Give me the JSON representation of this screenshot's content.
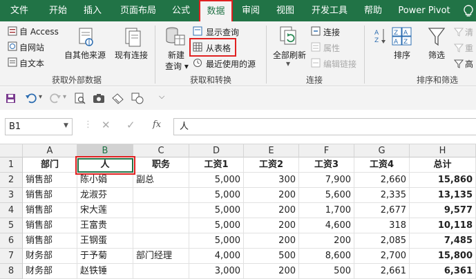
{
  "tabs": [
    {
      "label": "文件",
      "active": false
    },
    {
      "label": "开始",
      "active": false
    },
    {
      "label": "插入",
      "active": false
    },
    {
      "label": "页面布局",
      "active": false
    },
    {
      "label": "公式",
      "active": false
    },
    {
      "label": "数据",
      "active": true
    },
    {
      "label": "审阅",
      "active": false
    },
    {
      "label": "视图",
      "active": false
    },
    {
      "label": "开发工具",
      "active": false
    },
    {
      "label": "帮助",
      "active": false
    },
    {
      "label": "Power Pivot",
      "active": false
    }
  ],
  "ribbon": {
    "get_external": {
      "from_access": "自 Access",
      "from_web": "自网站",
      "from_text": "自文本",
      "other_sources": "自其他来源",
      "existing_conn": "现有连接",
      "group_name": "获取外部数据"
    },
    "get_transform": {
      "new_query_line1": "新建",
      "new_query_line2": "查询",
      "show_queries": "显示查询",
      "from_table": "从表格",
      "recent_sources": "最近使用的源",
      "group_name": "获取和转换"
    },
    "connections": {
      "refresh_all": "全部刷新",
      "connections": "连接",
      "properties": "属性",
      "edit_links": "编辑链接",
      "group_name": "连接"
    },
    "sort_filter": {
      "sort": "排序",
      "filter": "筛选",
      "clear": "清",
      "reapply": "重",
      "advanced": "高",
      "group_name": "排序和筛选"
    }
  },
  "formula_bar": {
    "name_box": "B1",
    "fx": "fx",
    "content": "人"
  },
  "sheet": {
    "columns": [
      "A",
      "B",
      "C",
      "D",
      "E",
      "F",
      "G",
      "H"
    ],
    "selected_column": "B",
    "rows": [
      {
        "n": "1",
        "cells": [
          "部门",
          "人",
          "职务",
          "工资1",
          "工资2",
          "工资3",
          "工资4",
          "总计"
        ]
      },
      {
        "n": "2",
        "cells": [
          "销售部",
          "陈小娟",
          "副总",
          "5,000",
          "300",
          "7,900",
          "2,660",
          "15,860"
        ]
      },
      {
        "n": "3",
        "cells": [
          "销售部",
          "龙淑芬",
          "",
          "5,000",
          "200",
          "5,600",
          "2,335",
          "13,135"
        ]
      },
      {
        "n": "4",
        "cells": [
          "销售部",
          "宋大莲",
          "",
          "5,000",
          "200",
          "1,700",
          "2,677",
          "9,577"
        ]
      },
      {
        "n": "5",
        "cells": [
          "销售部",
          "王富贵",
          "",
          "5,000",
          "200",
          "4,600",
          "318",
          "10,118"
        ]
      },
      {
        "n": "6",
        "cells": [
          "销售部",
          "王钢蛋",
          "",
          "5,000",
          "200",
          "200",
          "2,085",
          "7,485"
        ]
      },
      {
        "n": "7",
        "cells": [
          "财务部",
          "于予菊",
          "部门经理",
          "4,000",
          "500",
          "8,600",
          "2,700",
          "15,800"
        ]
      },
      {
        "n": "8",
        "cells": [
          "财务部",
          "赵铁锤",
          "",
          "3,000",
          "200",
          "500",
          "2,661",
          "6,361"
        ]
      }
    ]
  },
  "colors": {
    "excel_green": "#217346",
    "highlight_red": "#e02020"
  }
}
